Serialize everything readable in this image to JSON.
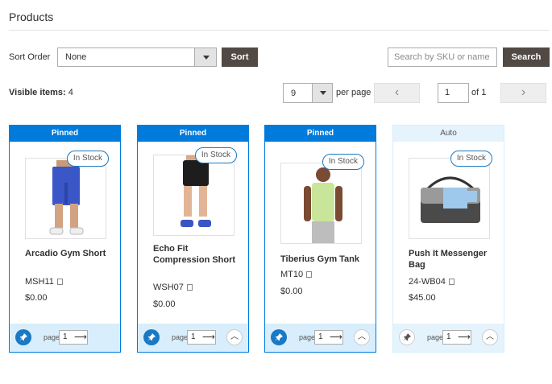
{
  "page": {
    "title": "Products"
  },
  "toolbar": {
    "sort_label": "Sort Order",
    "sort_value": "None",
    "sort_button": "Sort",
    "search_placeholder": "Search by SKU or name",
    "search_button": "Search"
  },
  "listing": {
    "visible_label": "Visible items:",
    "visible_count": "4",
    "per_page_value": "9",
    "per_page_label": "per page",
    "prev_glyph": "‹",
    "next_glyph": "›",
    "current_page": "1",
    "of_label": "of 1"
  },
  "products": [
    {
      "band": "Pinned",
      "stock": "In Stock",
      "name": "Arcadio Gym Short",
      "sku": "MSH11",
      "price": "$0.00",
      "page_label": "page",
      "page": "1",
      "pinned": true
    },
    {
      "band": "Pinned",
      "stock": "In Stock",
      "name": "Echo Fit Compression Short",
      "sku": "WSH07",
      "price": "$0.00",
      "page_label": "page",
      "page": "1",
      "pinned": true
    },
    {
      "band": "Pinned",
      "stock": "In Stock",
      "name": "Tiberius Gym Tank",
      "sku": "MT10",
      "price": "$0.00",
      "page_label": "page",
      "page": "1",
      "pinned": true
    },
    {
      "band": "Auto",
      "stock": "In Stock",
      "name": "Push It Messenger Bag",
      "sku": "24-WB04",
      "price": "$45.00",
      "page_label": "page",
      "page": "1",
      "pinned": false
    }
  ],
  "colors": {
    "accent": "#007bdb",
    "dark_button": "#514943",
    "auto_band": "#e5f3fd"
  },
  "icons": {
    "pin": "pin-icon",
    "copy": "copy-icon",
    "go": "arrow-right-icon",
    "up": "chevron-up-icon"
  }
}
